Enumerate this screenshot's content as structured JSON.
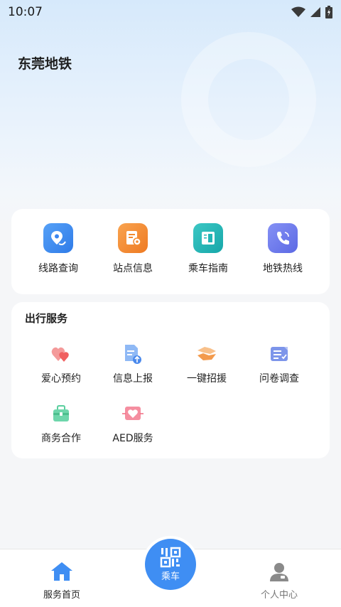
{
  "status": {
    "time": "10:07"
  },
  "header": {
    "title": "东莞地铁"
  },
  "quick_actions": [
    {
      "label": "线路查询",
      "icon": "route-pin-icon",
      "color": "#3b86f0"
    },
    {
      "label": "站点信息",
      "icon": "station-info-icon",
      "color": "#f38b2f"
    },
    {
      "label": "乘车指南",
      "icon": "guide-book-icon",
      "color": "#21b5b5"
    },
    {
      "label": "地铁热线",
      "icon": "phone-icon",
      "color": "#6a78ec"
    }
  ],
  "services": {
    "title": "出行服务",
    "items": [
      {
        "label": "爱心预约",
        "icon": "hearts-icon",
        "color": "#f06b6b"
      },
      {
        "label": "信息上报",
        "icon": "report-upload-icon",
        "color": "#5b98ef"
      },
      {
        "label": "一键招援",
        "icon": "handshake-icon",
        "color": "#f5a25a"
      },
      {
        "label": "问卷调查",
        "icon": "survey-icon",
        "color": "#6a86e8"
      },
      {
        "label": "商务合作",
        "icon": "briefcase-icon",
        "color": "#5bcf9f"
      },
      {
        "label": "AED服务",
        "icon": "aed-heart-icon",
        "color": "#f06b80"
      }
    ]
  },
  "tabbar": {
    "home": {
      "label": "服务首页",
      "color": "#3f8ef3"
    },
    "ride": {
      "label": "乘车"
    },
    "profile": {
      "label": "个人中心",
      "color": "#777777"
    }
  }
}
